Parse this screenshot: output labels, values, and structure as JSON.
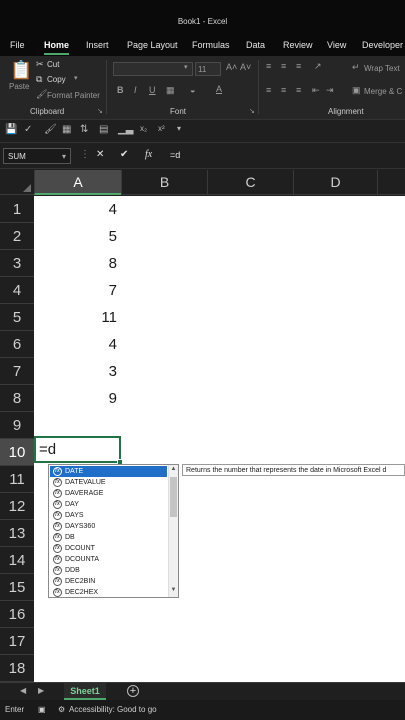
{
  "window": {
    "title": "Book1 - Excel"
  },
  "ribbon_tabs": [
    {
      "label": "File",
      "active": false
    },
    {
      "label": "Home",
      "active": true
    },
    {
      "label": "Insert",
      "active": false
    },
    {
      "label": "Page Layout",
      "active": false
    },
    {
      "label": "Formulas",
      "active": false
    },
    {
      "label": "Data",
      "active": false
    },
    {
      "label": "Review",
      "active": false
    },
    {
      "label": "View",
      "active": false
    },
    {
      "label": "Developer",
      "active": false
    }
  ],
  "clipboard": {
    "paste": "Paste",
    "cut": "Cut",
    "copy": "Copy",
    "format_painter": "Format Painter",
    "group_label": "Clipboard"
  },
  "font": {
    "size": "11",
    "bold": "B",
    "italic": "I",
    "underline": "U",
    "grow": "A˄",
    "shrink": "A˅",
    "group_label": "Font"
  },
  "alignment": {
    "wrap_text": "Wrap Text",
    "merge_center": "Merge & C",
    "group_label": "Alignment"
  },
  "formula_bar": {
    "name_box": "SUM",
    "cancel": "✕",
    "enter": "✔",
    "fx": "fx",
    "formula": "=d"
  },
  "columns": [
    "A",
    "B",
    "C",
    "D"
  ],
  "rows": [
    "1",
    "2",
    "3",
    "4",
    "5",
    "6",
    "7",
    "8",
    "9",
    "10",
    "11",
    "12",
    "13",
    "14",
    "15",
    "16",
    "17",
    "18"
  ],
  "cells_a": [
    "4",
    "5",
    "8",
    "7",
    "11",
    "4",
    "3",
    "9"
  ],
  "active_cell": {
    "ref": "A10",
    "value": "=d"
  },
  "autocomplete": {
    "items": [
      "DATE",
      "DATEVALUE",
      "DAVERAGE",
      "DAY",
      "DAYS",
      "DAYS360",
      "DB",
      "DCOUNT",
      "DCOUNTA",
      "DDB",
      "DEC2BIN",
      "DEC2HEX"
    ],
    "selected_index": 0,
    "tooltip": "Returns the number that represents the date in Microsoft Excel d"
  },
  "sheets": [
    {
      "name": "Sheet1",
      "active": true
    }
  ],
  "status": {
    "mode": "Enter",
    "accessibility": "Accessibility: Good to go"
  },
  "colors": {
    "accent": "#217346",
    "highlight": "#1f6fc9",
    "tab_underline": "#4fa86b"
  }
}
